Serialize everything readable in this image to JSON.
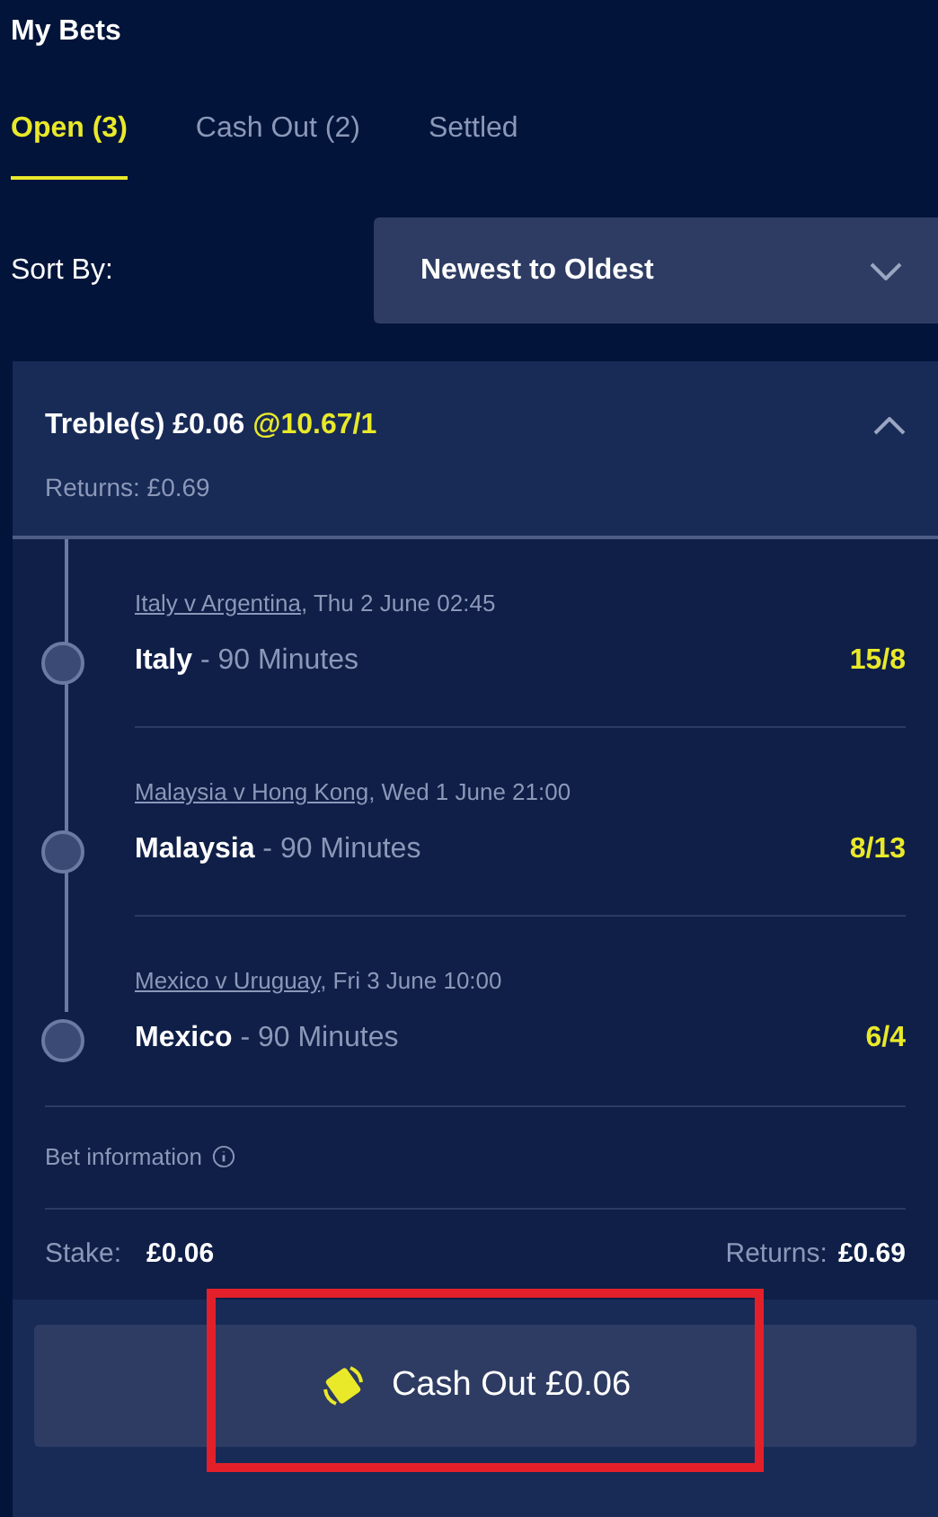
{
  "title": "My Bets",
  "tabs": [
    {
      "label": "Open (3)",
      "selected": true
    },
    {
      "label": "Cash Out (2)",
      "selected": false
    },
    {
      "label": "Settled",
      "selected": false
    }
  ],
  "sort": {
    "label": "Sort By:",
    "value": "Newest to Oldest"
  },
  "bet": {
    "title": "Treble(s) £0.06",
    "odds": "@10.67/1",
    "expanded": true,
    "returns": "Returns: £0.69",
    "legs": [
      {
        "event": "Italy v Argentina",
        "time": ", Thu 2 June 02:45",
        "selection": "Italy",
        "market": " - 90 Minutes",
        "price": "15/8"
      },
      {
        "event": "Malaysia v Hong Kong",
        "time": ", Wed 1 June 21:00",
        "selection": "Malaysia",
        "market": " - 90 Minutes",
        "price": "8/13"
      },
      {
        "event": "Mexico v Uruguay",
        "time": ", Fri 3 June 10:00",
        "selection": "Mexico",
        "market": " - 90 Minutes",
        "price": "6/4"
      }
    ],
    "info_label": "Bet information",
    "stake_label": "Stake:",
    "stake": "£0.06",
    "returns_label": "Returns:",
    "returns_value": "£0.69",
    "cash_out": "Cash Out £0.06",
    "highlighted": true
  }
}
